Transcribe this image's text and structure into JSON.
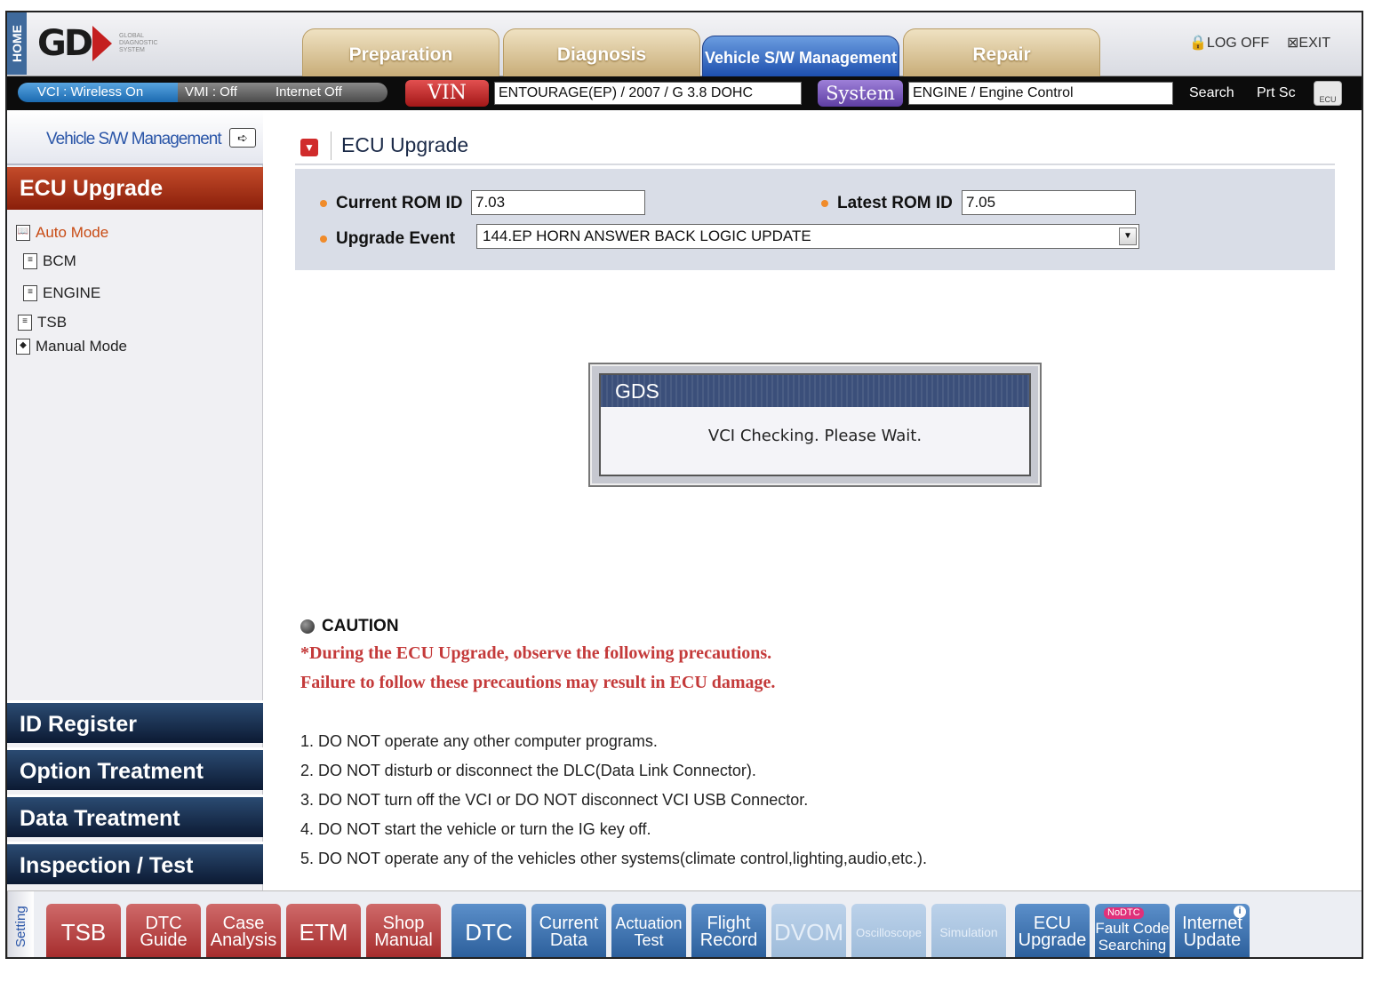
{
  "header": {
    "home_label": "HOME",
    "logo_text": "GD",
    "logo_subtitle": "GLOBAL DIAGNOSTIC SYSTEM",
    "tabs": [
      {
        "label": "Preparation"
      },
      {
        "label": "Diagnosis"
      },
      {
        "label": "Vehicle S/W Management"
      },
      {
        "label": "Repair"
      }
    ],
    "log_off": "LOG OFF",
    "exit": "EXIT"
  },
  "toolbar": {
    "vci_status": "VCI : Wireless On",
    "vmi_status": "VMI : Off",
    "internet_status": "Internet Off",
    "vin_label": "VIN",
    "vin_value": "ENTOURAGE(EP) / 2007 / G 3.8 DOHC",
    "system_label": "System",
    "system_value": "ENGINE / Engine Control",
    "search": "Search",
    "prt_sc": "Prt Sc",
    "ecu_icon_label": "ECU"
  },
  "sidebar": {
    "header": "Vehicle S/W Management",
    "active_section": "ECU Upgrade",
    "tree": [
      {
        "label": "Auto Mode"
      },
      {
        "label": "BCM"
      },
      {
        "label": "ENGINE"
      },
      {
        "label": "TSB"
      },
      {
        "label": "Manual Mode"
      }
    ],
    "categories": [
      {
        "label": "ID Register"
      },
      {
        "label": "Option Treatment"
      },
      {
        "label": "Data Treatment"
      },
      {
        "label": "Inspection / Test"
      }
    ]
  },
  "main": {
    "title": "ECU Upgrade",
    "current_rom_label": "Current ROM ID",
    "current_rom_value": "7.03",
    "latest_rom_label": "Latest ROM ID",
    "latest_rom_value": "7.05",
    "upgrade_event_label": "Upgrade Event",
    "upgrade_event_value": "144.EP HORN ANSWER BACK LOGIC UPDATE"
  },
  "dialog": {
    "title": "GDS",
    "message": "VCI Checking. Please Wait."
  },
  "caution": {
    "heading": "CAUTION",
    "lines": [
      "*During the ECU Upgrade, observe the following precautions.",
      "Failure to follow these precautions may result in ECU damage."
    ],
    "rules": [
      "1. DO NOT operate any other computer programs.",
      "2. DO NOT disturb or disconnect the DLC(Data Link Connector).",
      "3. DO NOT turn off the VCI or DO NOT disconnect VCI USB Connector.",
      "4. DO NOT start the vehicle or turn the IG key off.",
      "5. DO NOT operate any of the vehicles other systems(climate control,lighting,audio,etc.)."
    ]
  },
  "bottom_bar": {
    "setting": "Setting",
    "buttons": [
      {
        "label": "TSB"
      },
      {
        "label": "DTC\nGuide"
      },
      {
        "label": "Case\nAnalysis"
      },
      {
        "label": "ETM"
      },
      {
        "label": "Shop\nManual"
      },
      {
        "label": "DTC"
      },
      {
        "label": "Current\nData"
      },
      {
        "label": "Actuation\nTest"
      },
      {
        "label": "Flight\nRecord"
      },
      {
        "label": "DVOM"
      },
      {
        "label": "Oscilloscope"
      },
      {
        "label": "Simulation"
      },
      {
        "label": "ECU\nUpgrade"
      },
      {
        "label": "Fault Code\nSearching",
        "badge": "NoDTC"
      },
      {
        "label": "Internet\nUpdate",
        "info": "i"
      }
    ]
  }
}
